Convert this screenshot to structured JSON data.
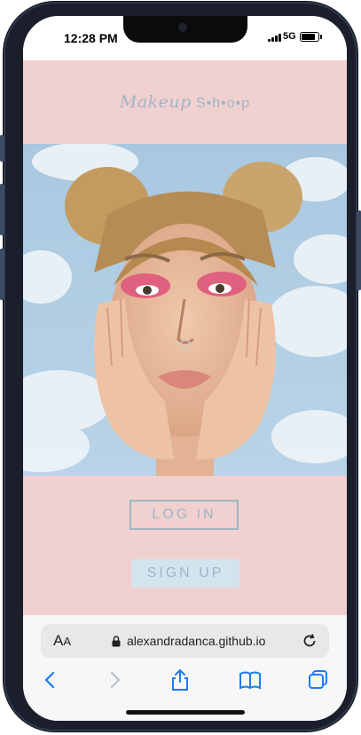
{
  "status_bar": {
    "time": "12:28 PM",
    "network": "5G"
  },
  "site": {
    "logo_script": "Makeup",
    "logo_shop": "S•h•o•p",
    "login_label": "LOG IN",
    "signup_label": "SIGN UP"
  },
  "browser": {
    "text_size_label": "A",
    "text_size_small": "A",
    "url": "alexandradanca.github.io"
  },
  "colors": {
    "page_bg": "#f1d0d0",
    "accent": "#9cb6c6",
    "signup_bg": "#d4e4ef",
    "safari_blue": "#1d7bf0"
  },
  "icons": [
    "lock-icon",
    "reload-icon",
    "back-icon",
    "forward-icon",
    "share-icon",
    "bookmarks-icon",
    "tabs-icon"
  ]
}
